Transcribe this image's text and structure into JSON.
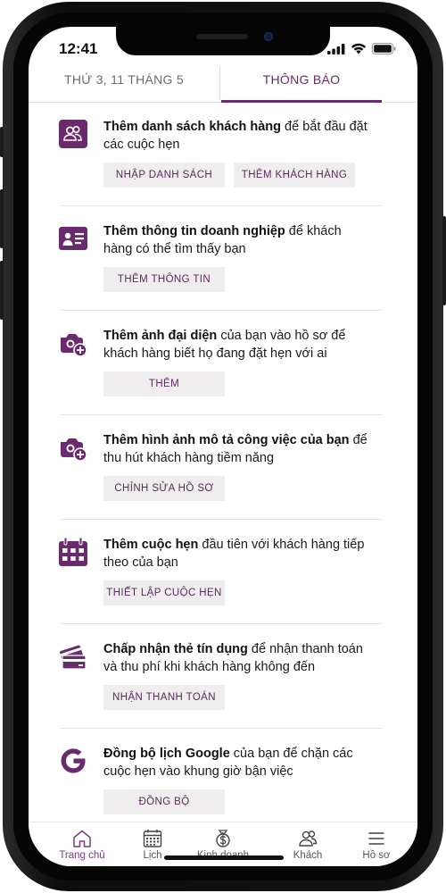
{
  "status": {
    "time": "12:41"
  },
  "tabs": {
    "date": "THỨ 3, 11 THÁNG 5",
    "notifications": "THÔNG BÁO"
  },
  "items": [
    {
      "icon": "people-icon",
      "bold": "Thêm danh sách khách hàng",
      "rest": " để bắt đầu đặt các cuộc hẹn",
      "actions": [
        "NHẬP DANH SÁCH",
        "THÊM KHÁCH HÀNG"
      ]
    },
    {
      "icon": "business-card-icon",
      "bold": "Thêm thông tin doanh nghiệp",
      "rest": " để khách hàng có thể tìm thấy bạn",
      "actions": [
        "THÊM THÔNG TIN"
      ]
    },
    {
      "icon": "add-photo-icon",
      "bold": "Thêm ảnh đại diện",
      "rest": " của bạn vào hồ sơ để khách hàng biết họ đang đặt hẹn với ai",
      "actions": [
        "THÊM"
      ]
    },
    {
      "icon": "add-photo-icon",
      "bold": "Thêm hình ảnh mô tả công việc của bạn",
      "rest": " để thu hút khách hàng tiềm năng",
      "actions": [
        "CHỈNH SỬA HỒ SƠ"
      ]
    },
    {
      "icon": "calendar-icon",
      "bold": "Thêm cuộc hẹn",
      "rest": " đầu tiên với khách hàng tiếp theo của bạn",
      "actions": [
        "THIẾT LẬP CUỘC HẸN"
      ]
    },
    {
      "icon": "credit-card-icon",
      "bold": "Chấp nhận thẻ tín dụng",
      "rest": " để nhận thanh toán và thu phí khi khách hàng không đến",
      "actions": [
        "NHẬN THANH TOÁN"
      ]
    },
    {
      "icon": "google-icon",
      "bold": "Đồng bộ lịch Google",
      "rest": " của bạn để chặn các cuộc hẹn vào khung giờ bận việc",
      "actions": [
        "ĐỒNG BỘ"
      ]
    }
  ],
  "nav": [
    {
      "label": "Trang chủ",
      "icon": "home-icon",
      "active": true
    },
    {
      "label": "Lịch",
      "icon": "calendar-grid-icon",
      "active": false
    },
    {
      "label": "Kinh doanh",
      "icon": "money-icon",
      "active": false
    },
    {
      "label": "Khách",
      "icon": "customers-icon",
      "active": false
    },
    {
      "label": "Hồ sơ",
      "icon": "menu-icon",
      "active": false
    }
  ],
  "colors": {
    "accent": "#6a2b6e",
    "button_bg": "#efeded"
  }
}
